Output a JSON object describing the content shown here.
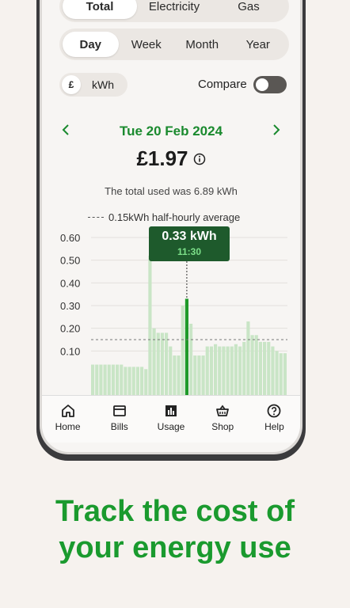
{
  "fuel_tabs": [
    "Total",
    "Electricity",
    "Gas"
  ],
  "fuel_selected": "Total",
  "period_tabs": [
    "Day",
    "Week",
    "Month",
    "Year"
  ],
  "period_selected": "Day",
  "unit_toggle": {
    "pound": "£",
    "kwh": "kWh"
  },
  "compare": {
    "label": "Compare",
    "on": false
  },
  "date": "Tue 20 Feb 2024",
  "amount": "£1.97",
  "total_text": "The total used was 6.89 kWh",
  "average_legend": "0.15kWh half-hourly average",
  "tooltip": {
    "value": "0.33 kWh",
    "time": "11:30"
  },
  "tabbar": [
    {
      "label": "Home",
      "icon": "home-icon"
    },
    {
      "label": "Bills",
      "icon": "bills-icon"
    },
    {
      "label": "Usage",
      "icon": "usage-icon"
    },
    {
      "label": "Shop",
      "icon": "shop-icon"
    },
    {
      "label": "Help",
      "icon": "help-icon"
    }
  ],
  "headline": [
    "Track the cost of",
    "your energy use"
  ],
  "colors": {
    "accent": "#1a8a2e",
    "bar": "#c9e5c6",
    "bar_selected": "#1f9a2a",
    "tooltip_bg": "#1e5a2c"
  },
  "chart_data": {
    "type": "bar",
    "ylabel": "kWh",
    "yticks": [
      "0.60",
      "0.50",
      "0.40",
      "0.30",
      "0.20",
      "0.10"
    ],
    "ylim": [
      0,
      0.6
    ],
    "average": 0.15,
    "selected_index": 23,
    "values": [
      0.04,
      0.04,
      0.04,
      0.04,
      0.04,
      0.04,
      0.04,
      0.04,
      0.03,
      0.03,
      0.03,
      0.03,
      0.03,
      0.02,
      0.52,
      0.2,
      0.18,
      0.18,
      0.18,
      0.12,
      0.08,
      0.08,
      0.3,
      0.33,
      0.22,
      0.08,
      0.08,
      0.08,
      0.12,
      0.12,
      0.13,
      0.12,
      0.12,
      0.12,
      0.12,
      0.13,
      0.12,
      0.14,
      0.23,
      0.17,
      0.17,
      0.14,
      0.14,
      0.14,
      0.12,
      0.1,
      0.09,
      0.09
    ]
  }
}
